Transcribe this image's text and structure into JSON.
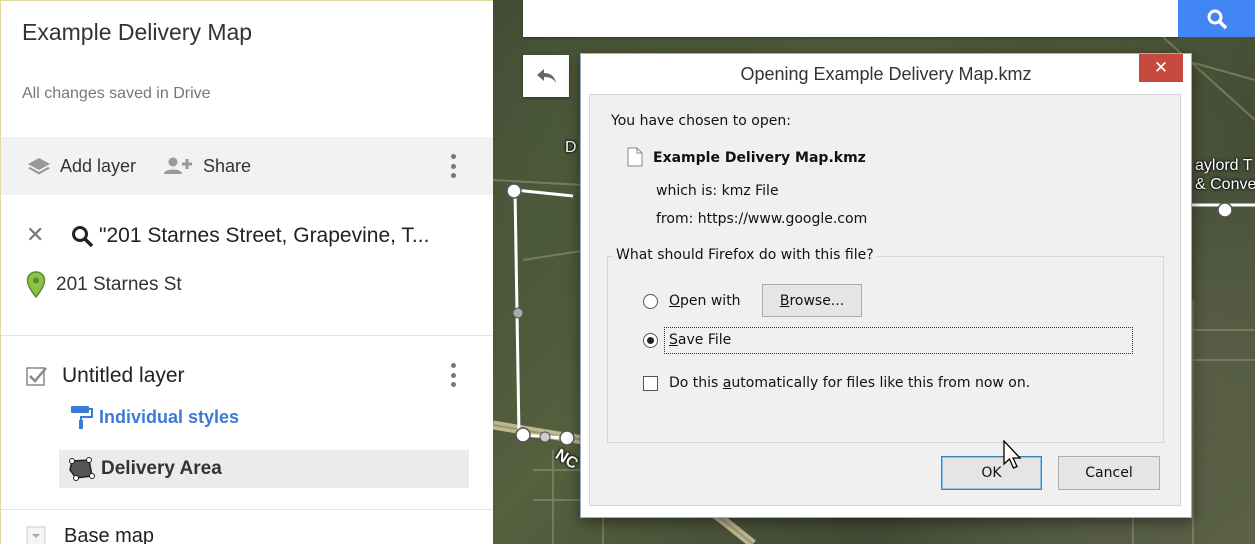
{
  "panel": {
    "title": "Example Delivery Map",
    "save_status": "All changes saved in Drive",
    "toolbar": {
      "add_layer": "Add layer",
      "share": "Share"
    },
    "search": {
      "query": "\"201 Starnes Street, Grapevine, T..."
    },
    "result": {
      "label": "201 Starnes St",
      "pin_color": "#8bc34a"
    },
    "layer": {
      "name": "Untitled layer",
      "checked": true,
      "styles": "Individual styles",
      "feature": "Delivery Area"
    },
    "basemap": {
      "label": "Base map"
    }
  },
  "map": {
    "labels": {
      "road_letter": "D",
      "place_line1": "aylord T",
      "place_line2": "& Conver",
      "road_bottom": "NC"
    },
    "accent": "#4285f4"
  },
  "dialog": {
    "title": "Opening Example Delivery Map.kmz",
    "close": "✕",
    "intro": "You have chosen to open:",
    "file_name": "Example Delivery Map.kmz",
    "which_is_label": "which is:",
    "which_is_value": "kmz File",
    "from_label": "from:",
    "from_value": "https://www.google.com",
    "question": "What should Firefox do with this file?",
    "open_with_pre": "",
    "open_with_ul": "O",
    "open_with_post": "pen with",
    "browse_ul": "B",
    "browse_post": "rowse...",
    "save_ul": "S",
    "save_post": "ave File",
    "auto_pre": "Do this ",
    "auto_ul": "a",
    "auto_post": "utomatically for files like this from now on.",
    "selected_action": "Save File",
    "ok": "OK",
    "cancel": "Cancel"
  }
}
